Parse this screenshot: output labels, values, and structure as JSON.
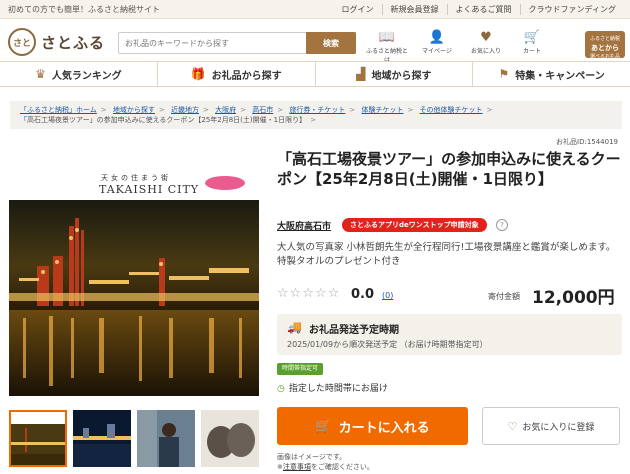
{
  "topbar": {
    "tagline": "初めての方でも簡単！ふるさと納税サイト",
    "links": [
      "ログイン",
      "新規会員登録",
      "よくあるご質問",
      "クラウドファンディング"
    ]
  },
  "header": {
    "logo_mark": "さと",
    "logo_text": "さとふる",
    "search_placeholder": "お礼品のキーワードから探す",
    "search_button": "検索",
    "icons": [
      {
        "name": "book-icon",
        "label": "ふるさと納税とは"
      },
      {
        "name": "user-icon",
        "label": "マイページ"
      },
      {
        "name": "heart-icon",
        "label": "お気に入り"
      },
      {
        "name": "cart-icon",
        "label": "カート"
      }
    ],
    "badge": {
      "small": "ふるさと納税",
      "main": "あとから",
      "sub": "選べるお礼品"
    }
  },
  "nav": [
    {
      "icon": "crown-icon",
      "label": "人気ランキング"
    },
    {
      "icon": "gift-icon",
      "label": "お礼品から探す"
    },
    {
      "icon": "region-icon",
      "label": "地域から探す"
    },
    {
      "icon": "flag-icon",
      "label": "特集・キャンペーン"
    }
  ],
  "breadcrumb": [
    "「ふるさと納税」ホーム",
    "地域から探す",
    "近畿地方",
    "大阪府",
    "高石市",
    "旅行券・チケット",
    "体験チケット",
    "その他体験チケット"
  ],
  "breadcrumb_current": "「高石工場夜景ツアー」の参加申込みに使えるクーポン【25年2月8日(土)開催・1日限り】",
  "item_number": "お礼品ID:1544019",
  "image": {
    "caption_small": "天女の住まう街",
    "caption_city": "TAKAISHI CITY"
  },
  "title": "「高石工場夜景ツアー」の参加申込みに使えるクーポン【25年2月8日(土)開催・1日限り】",
  "region": "大阪府高石市",
  "app_badge": "さとふるアプリdeワンストップ申請対象",
  "description": "大人気の写真家 小林哲朗先生が全行程同行!工場夜景講座と鑑賞が楽しめます。特製タオルのプレゼント付き",
  "rating": {
    "stars": "☆☆☆☆☆",
    "score": "0.0",
    "count": "(0)",
    "value": 0
  },
  "price": {
    "label": "寄付金額",
    "amount": "12,000円"
  },
  "shipping": {
    "title": "お礼品発送予定時期",
    "date": "2025/01/09から順次発送予定 （お届け時期帯指定可）"
  },
  "time_badge": "時間帯指定可",
  "time_text": "指定した時間帯にお届け",
  "cart_button": "カートに入れる",
  "fav_button": "お気に入りに登録",
  "notes": {
    "line1": "画像はイメージです。",
    "line2_prefix": "※",
    "line2_link": "注意事項",
    "line2_suffix": "をご確認ください。"
  },
  "colors": {
    "brand": "#a3743f",
    "cart": "#f06a00",
    "badge_red": "#e2231a",
    "link": "#1a5aa3",
    "green": "#5aa02c"
  }
}
